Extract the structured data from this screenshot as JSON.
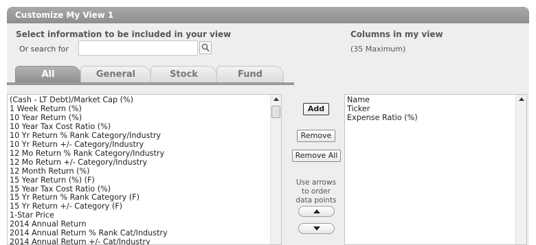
{
  "window": {
    "title": "Customize My View 1"
  },
  "selector": {
    "heading": "Select information to be included in your view",
    "search_label": "Or search for",
    "search_value": "",
    "search_placeholder": ""
  },
  "columns_panel": {
    "heading": "Columns in my view",
    "max_note": "(35 Maximum)"
  },
  "tabs": [
    {
      "label": "All",
      "active": true
    },
    {
      "label": "General",
      "active": false
    },
    {
      "label": "Stock",
      "active": false
    },
    {
      "label": "Fund",
      "active": false
    }
  ],
  "available_items": [
    "(Cash - LT Debt)/Market Cap (%)",
    "1 Week Return (%)",
    "10 Year Return (%)",
    "10 Year Tax Cost Ratio (%)",
    "10 Yr Return % Rank Category/Industry",
    "10 Yr Return +/- Category/Industry",
    "12 Mo Return % Rank Category/Industry",
    "12 Mo Return +/- Category/Industry",
    "12 Month Return (%)",
    "15 Year Return (%) (F)",
    "15 Year Tax Cost Ratio (%)",
    "15 Yr Return % Rank Category (F)",
    "15 Yr Return +/- Category (F)",
    "1-Star Price",
    "2014 Annual Return",
    "2014 Annual Return % Rank Cat/Industry",
    "2014 Annual Return +/- Cat/Industry"
  ],
  "selected_items": [
    "Name",
    "Ticker",
    "Expense Ratio (%)"
  ],
  "buttons": {
    "add": "Add",
    "remove": "Remove",
    "remove_all": "Remove All"
  },
  "order_hint": [
    "Use arrows",
    "to order",
    "data points"
  ],
  "icons": {
    "search": "magnifier-icon",
    "scroll_up": "triangle-up-icon",
    "move_up": "triangle-up-icon",
    "move_down": "triangle-down-icon"
  }
}
